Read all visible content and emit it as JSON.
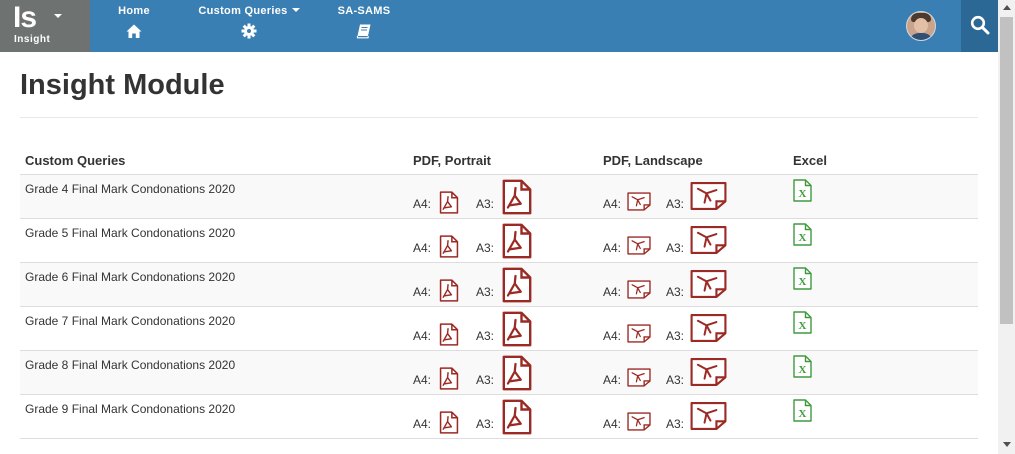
{
  "brand": {
    "logo": "Is",
    "subtitle": "Insight"
  },
  "nav": [
    {
      "label": "Home",
      "icon": "home-icon"
    },
    {
      "label": "Custom Queries",
      "icon": "gear-icon",
      "has_dropdown": true
    },
    {
      "label": "SA-SAMS",
      "icon": "book-icon"
    }
  ],
  "page": {
    "title": "Insight Module"
  },
  "table": {
    "headers": [
      "Custom Queries",
      "PDF, Portrait",
      "PDF, Landscape",
      "Excel"
    ],
    "a4_label": "A4:",
    "a3_label": "A3:",
    "rows": [
      {
        "name": "Grade 4 Final Mark Condonations 2020"
      },
      {
        "name": "Grade 5 Final Mark Condonations 2020"
      },
      {
        "name": "Grade 6 Final Mark Condonations 2020"
      },
      {
        "name": "Grade 7 Final Mark Condonations 2020"
      },
      {
        "name": "Grade 8 Final Mark Condonations 2020"
      },
      {
        "name": "Grade 9 Final Mark Condonations 2020"
      }
    ]
  },
  "colors": {
    "topbar": "#3a7fb4",
    "brand_bg": "#6e7372",
    "search_bg": "#2b6895",
    "pdf_red": "#9b2a24",
    "excel_green": "#3f9a3f"
  }
}
